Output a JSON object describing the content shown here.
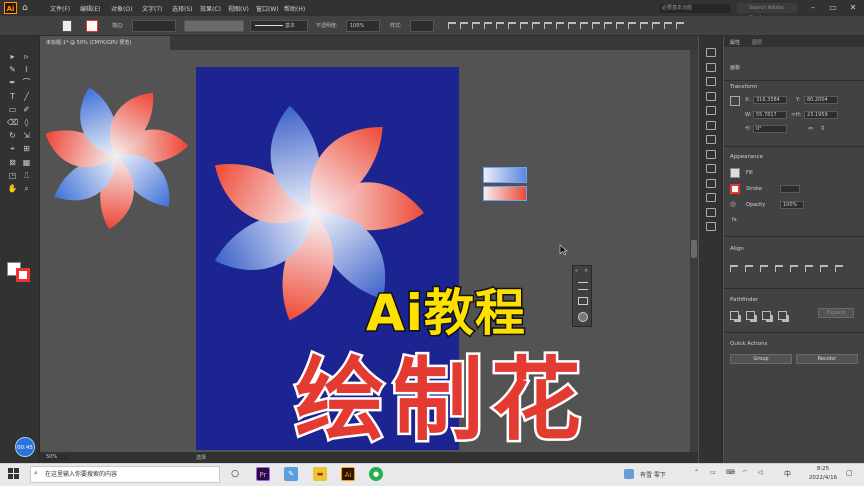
{
  "app": {
    "logo": "Ai",
    "workspace": "必要基本功能",
    "search_placeholder": "Search Adobe Stock"
  },
  "menu": [
    "文件(F)",
    "编辑(E)",
    "对象(O)",
    "文字(T)",
    "选择(S)",
    "效果(C)",
    "视图(V)",
    "窗口(W)",
    "帮助(H)"
  ],
  "control_bar": {
    "stroke_label": "描边:",
    "stroke_style": "基本",
    "opacity_label": "不透明度:",
    "opacity_value": "100%",
    "style_label": "样式:"
  },
  "document": {
    "tab_title": "未标题-1* @ 50% (CMYK/GPU 预览)",
    "zoom": "50%",
    "status": "选择"
  },
  "timer": "00:45",
  "panels": {
    "tabs": [
      "属性",
      "图层"
    ],
    "doc_label": "画板",
    "transform": {
      "title": "Transform",
      "x_label": "X:",
      "x": "316.3584",
      "y_label": "Y:",
      "y": "80.2004",
      "w_label": "W:",
      "w": "55.7817",
      "h_label": "H:",
      "h": "23.1959",
      "angle": "0°"
    },
    "appearance": {
      "title": "Appearance",
      "fill": "Fill",
      "stroke": "Stroke",
      "opacity": "Opacity",
      "opacity_value": "100%",
      "fx": "fx."
    },
    "align": {
      "title": "Align"
    },
    "pathfinder": {
      "title": "Pathfinder",
      "expand": "Expand"
    },
    "quick_actions": {
      "title": "Quick Actions",
      "group": "Group",
      "recolor": "Recolor"
    }
  },
  "overlay": {
    "title_line1": "Ai教程",
    "title_line2": "绘制花"
  },
  "taskbar": {
    "search_placeholder": "在这里输入你要搜索的内容",
    "weather": "有雪 零下",
    "lang": "中",
    "time": "8:25",
    "date": "2022/4/16"
  },
  "colors": {
    "artboard": "#1b2490",
    "petal_red": "#ee4433",
    "petal_blue": "#3f70d8",
    "title_yellow": "#ffe100",
    "title_red": "#e33b32"
  }
}
